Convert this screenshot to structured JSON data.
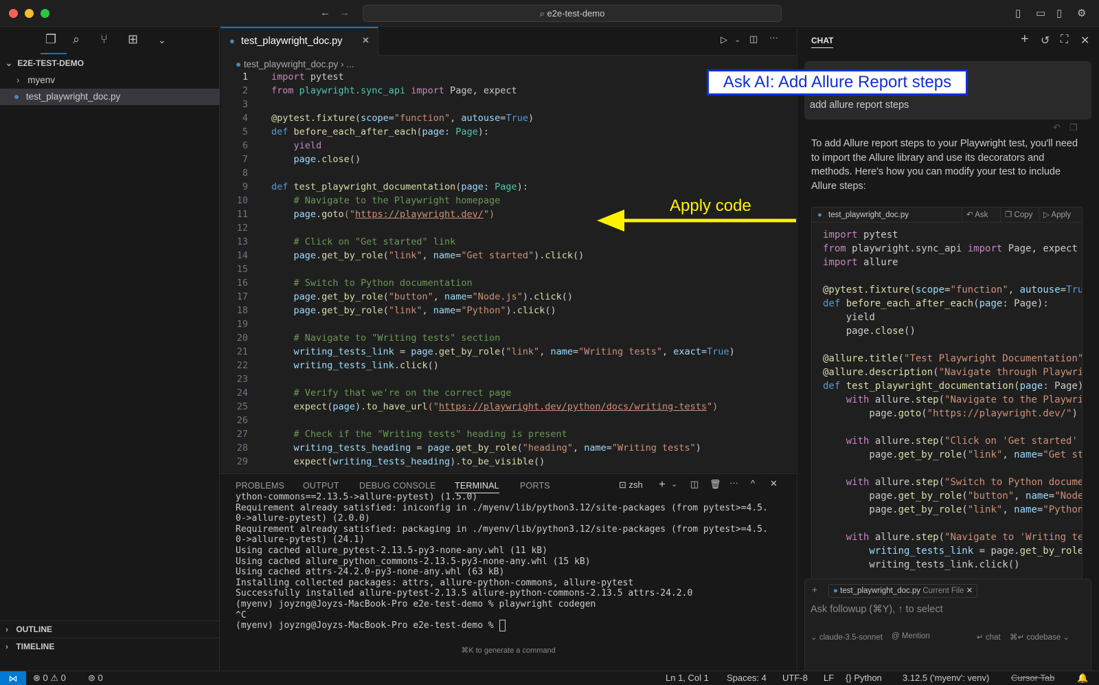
{
  "titlebar": {
    "search_text": "e2e-test-demo",
    "traffic_colors": [
      "#ff5f57",
      "#febc2e",
      "#28c840"
    ]
  },
  "sidebar": {
    "root_folder": "E2E-TEST-DEMO",
    "items": [
      {
        "label": "myenv",
        "kind": "folder"
      },
      {
        "label": "test_playwright_doc.py",
        "kind": "file"
      }
    ],
    "outline_label": "OUTLINE",
    "timeline_label": "TIMELINE"
  },
  "editor": {
    "tab_label": "test_playwright_doc.py",
    "breadcrumb_file": "test_playwright_doc.py",
    "breadcrumb_more": "...",
    "line_numbers": [
      "1",
      "2",
      "3",
      "4",
      "5",
      "6",
      "7",
      "8",
      "9",
      "10",
      "11",
      "12",
      "13",
      "14",
      "15",
      "16",
      "17",
      "18",
      "19",
      "20",
      "21",
      "22",
      "23",
      "24",
      "25",
      "26",
      "27",
      "28",
      "29"
    ],
    "lines": {
      "l1a": "import",
      "l1b": " pytest",
      "l2a": "from",
      "l2b": " playwright.sync_api ",
      "l2c": "import",
      "l2d": " Page, expect",
      "l4a": "@pytest.fixture",
      "l4b": "(",
      "l4c": "scope",
      "l4d": "=",
      "l4e": "\"function\"",
      "l4f": ", ",
      "l4g": "autouse",
      "l4h": "=",
      "l4i": "True",
      "l4j": ")",
      "l5a": "def",
      "l5b": " before_each_after_each",
      "l5c": "(",
      "l5d": "page",
      "l5e": ": ",
      "l5f": "Page",
      "l5g": "):",
      "l6": "    yield",
      "l7a": "    page",
      "l7b": ".",
      "l7c": "close",
      "l7d": "()",
      "l9a": "def",
      "l9b": " test_playwright_documentation",
      "l9c": "(",
      "l9d": "page",
      "l9e": ": ",
      "l9f": "Page",
      "l9g": "):",
      "l10": "    # Navigate to the Playwright homepage",
      "l11a": "    page",
      "l11b": ".",
      "l11c": "goto",
      "l11d": "(\"",
      "l11e": "https://playwright.dev/",
      "l11f": "\")",
      "l13": "    # Click on \"Get started\" link",
      "l14a": "    page",
      "l14b": ".",
      "l14c": "get_by_role",
      "l14d": "(",
      "l14e": "\"link\"",
      "l14f": ", ",
      "l14g": "name",
      "l14h": "=",
      "l14i": "\"Get started\"",
      "l14j": ").",
      "l14k": "click",
      "l14l": "()",
      "l16": "    # Switch to Python documentation",
      "l17a": "    page",
      "l17b": ".",
      "l17c": "get_by_role",
      "l17d": "(",
      "l17e": "\"button\"",
      "l17f": ", ",
      "l17g": "name",
      "l17h": "=",
      "l17i": "\"Node.js\"",
      "l17j": ").",
      "l17k": "click",
      "l17l": "()",
      "l18a": "    page",
      "l18b": ".",
      "l18c": "get_by_role",
      "l18d": "(",
      "l18e": "\"link\"",
      "l18f": ", ",
      "l18g": "name",
      "l18h": "=",
      "l18i": "\"Python\"",
      "l18j": ").",
      "l18k": "click",
      "l18l": "()",
      "l20": "    # Navigate to \"Writing tests\" section",
      "l21a": "    writing_tests_link",
      "l21b": " = ",
      "l21c": "page",
      "l21d": ".",
      "l21e": "get_by_role",
      "l21f": "(",
      "l21g": "\"link\"",
      "l21h": ", ",
      "l21i": "name",
      "l21j": "=",
      "l21k": "\"Writing tests\"",
      "l21l": ", ",
      "l21m": "exact",
      "l21n": "=",
      "l21o": "True",
      "l21p": ")",
      "l22a": "    writing_tests_link",
      "l22b": ".",
      "l22c": "click",
      "l22d": "()",
      "l24": "    # Verify that we're on the correct page",
      "l25a": "    expect",
      "l25b": "(",
      "l25c": "page",
      "l25d": ").",
      "l25e": "to_have_url",
      "l25f": "(\"",
      "l25g": "https://playwright.dev/python/docs/writing-tests",
      "l25h": "\")",
      "l27": "    # Check if the \"Writing tests\" heading is present",
      "l28a": "    writing_tests_heading",
      "l28b": " = ",
      "l28c": "page",
      "l28d": ".",
      "l28e": "get_by_role",
      "l28f": "(",
      "l28g": "\"heading\"",
      "l28h": ", ",
      "l28i": "name",
      "l28j": "=",
      "l28k": "\"Writing tests\"",
      "l28l": ")",
      "l29a": "    expect",
      "l29b": "(",
      "l29c": "writing_tests_heading",
      "l29d": ").",
      "l29e": "to_be_visible",
      "l29f": "()"
    }
  },
  "panel": {
    "tabs": [
      "PROBLEMS",
      "OUTPUT",
      "DEBUG CONSOLE",
      "TERMINAL",
      "PORTS"
    ],
    "active_tab": "TERMINAL",
    "shell_label": "zsh",
    "terminal_lines": [
      "ython-commons==2.13.5->allure-pytest) (1.5.0)",
      "Requirement already satisfied: iniconfig in ./myenv/lib/python3.12/site-packages (from pytest>=4.5.",
      "0->allure-pytest) (2.0.0)",
      "Requirement already satisfied: packaging in ./myenv/lib/python3.12/site-packages (from pytest>=4.5.",
      "0->allure-pytest) (24.1)",
      "Using cached allure_pytest-2.13.5-py3-none-any.whl (11 kB)",
      "Using cached allure_python_commons-2.13.5-py3-none-any.whl (15 kB)",
      "Using cached attrs-24.2.0-py3-none-any.whl (63 kB)",
      "Installing collected packages: attrs, allure-python-commons, allure-pytest",
      "Successfully installed allure-pytest-2.13.5 allure-python-commons-2.13.5 attrs-24.2.0",
      "(myenv) joyzng@Joyzs-MacBook-Pro e2e-test-demo % playwright codegen",
      "^C",
      "(myenv) joyzng@Joyzs-MacBook-Pro e2e-test-demo % "
    ],
    "hint": "⌘K to generate a command"
  },
  "chat": {
    "header": "CHAT",
    "user_message": "add allure report steps",
    "response_intro": "To add Allure report steps to your Playwright test, you'll need to import the Allure library and use its decorators and methods. Here's how you can modify your test to include Allure steps:",
    "code_card": {
      "filename": "test_playwright_doc.py",
      "ask_label": "Ask",
      "copy_label": "Copy",
      "apply_label": "Apply",
      "lines": {
        "c1a": "import",
        "c1b": " pytest",
        "c2a": "from",
        "c2b": " playwright.sync_api ",
        "c2c": "import",
        "c2d": " Page, expect",
        "c3a": "import",
        "c3b": " allure",
        "c5a": "@pytest.fixture",
        "c5b": "(",
        "c5c": "scope",
        "c5d": "=",
        "c5e": "\"function\"",
        "c5f": ", ",
        "c5g": "autouse",
        "c5h": "=",
        "c5i": "Tru",
        "c6a": "def",
        "c6b": " before_each_after_each",
        "c6c": "(",
        "c6d": "page",
        "c6e": ": Page):",
        "c7": "    yield",
        "c8a": "    page.",
        "c8b": "close",
        "c8c": "()",
        "c10a": "@allure.title",
        "c10b": "(",
        "c10c": "\"Test Playwright Documentation\"",
        "c11a": "@allure.description",
        "c11b": "(",
        "c11c": "\"Navigate through Playwri",
        "c12a": "def",
        "c12b": " test_playwright_documentation",
        "c12c": "(",
        "c12d": "page",
        "c12e": ": Page)",
        "c13a": "    with",
        "c13b": " allure.",
        "c13c": "step",
        "c13d": "(",
        "c13e": "\"Navigate to the Playwri",
        "c14a": "        page.",
        "c14b": "goto",
        "c14c": "(",
        "c14d": "\"https://playwright.dev/\"",
        "c14e": ")",
        "c16a": "    with",
        "c16b": " allure.",
        "c16c": "step",
        "c16d": "(",
        "c16e": "\"Click on 'Get started'",
        "c17a": "        page.",
        "c17b": "get_by_role",
        "c17c": "(",
        "c17d": "\"link\"",
        "c17e": ", ",
        "c17f": "name",
        "c17g": "=",
        "c17h": "\"Get st",
        "c19a": "    with",
        "c19b": " allure.",
        "c19c": "step",
        "c19d": "(",
        "c19e": "\"Switch to Python docume",
        "c20a": "        page.",
        "c20b": "get_by_role",
        "c20c": "(",
        "c20d": "\"button\"",
        "c20e": ", ",
        "c20f": "name",
        "c20g": "=",
        "c20h": "\"Node",
        "c21a": "        page.",
        "c21b": "get_by_role",
        "c21c": "(",
        "c21d": "\"link\"",
        "c21e": ", ",
        "c21f": "name",
        "c21g": "=",
        "c21h": "\"Python",
        "c23a": "    with",
        "c23b": " allure.",
        "c23c": "step",
        "c23d": "(",
        "c23e": "\"Navigate to 'Writing te",
        "c24a": "        writing_tests_link",
        "c24b": " = page.",
        "c24c": "get_by_role",
        "c25": "        writing_tests_link.click()"
      }
    },
    "followup": {
      "chip_file": "test_playwright_doc.py",
      "chip_tag": "Current File",
      "placeholder": "Ask followup (⌘Y), ↑ to select",
      "model": "claude-3.5-sonnet",
      "mention": "Mention",
      "chat_label": "chat",
      "codebase_label": "codebase"
    }
  },
  "annotations": {
    "ask_banner": "Ask AI: Add Allure Report steps",
    "apply_label": "Apply code",
    "highlight_colors": {
      "banner_border": "#0f2fd6",
      "arrow": "#fff200"
    }
  },
  "statusbar": {
    "errors": "0",
    "warnings": "0",
    "ports": "0",
    "cursor": "Ln 1, Col 1",
    "spaces": "Spaces: 4",
    "encoding": "UTF-8",
    "eol": "LF",
    "language": "Python",
    "interpreter": "3.12.5 ('myenv': venv)",
    "cursor_tab": "Cursor Tab"
  }
}
